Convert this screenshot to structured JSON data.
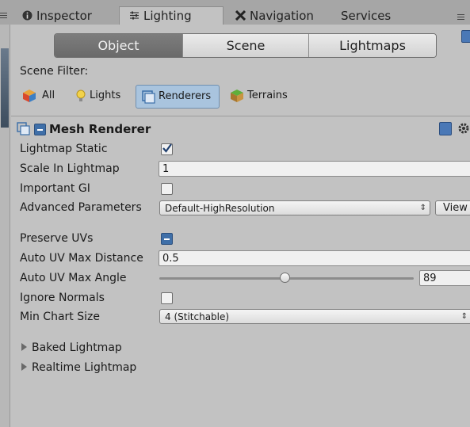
{
  "tabs": [
    {
      "label": "Inspector",
      "icon": "info-icon",
      "active": false
    },
    {
      "label": "Lighting",
      "icon": "lighting-icon",
      "active": true
    },
    {
      "label": "Navigation",
      "icon": "navigation-icon",
      "active": false
    },
    {
      "label": "Services",
      "icon": "",
      "active": false
    }
  ],
  "mode_tabs": [
    {
      "label": "Object",
      "active": true
    },
    {
      "label": "Scene",
      "active": false
    },
    {
      "label": "Lightmaps",
      "active": false
    }
  ],
  "scene_filter": {
    "label": "Scene Filter:",
    "buttons": [
      {
        "label": "All",
        "icon": "all-cube-icon",
        "active": false
      },
      {
        "label": "Lights",
        "icon": "light-bulb-icon",
        "active": false
      },
      {
        "label": "Renderers",
        "icon": "renderer-icon",
        "active": true
      },
      {
        "label": "Terrains",
        "icon": "terrain-icon",
        "active": false
      }
    ]
  },
  "component": {
    "title": "Mesh Renderer",
    "icon": "mesh-renderer-icon"
  },
  "properties": {
    "lightmap_static": {
      "label": "Lightmap Static",
      "checked": true
    },
    "scale_in_lightmap": {
      "label": "Scale In Lightmap",
      "value": "1"
    },
    "important_gi": {
      "label": "Important GI",
      "checked": false
    },
    "advanced_parameters": {
      "label": "Advanced Parameters",
      "value": "Default-HighResolution",
      "view_label": "View"
    },
    "preserve_uvs": {
      "label": "Preserve UVs",
      "state": "mixed"
    },
    "auto_uv_max_distance": {
      "label": "Auto UV Max Distance",
      "value": "0.5"
    },
    "auto_uv_max_angle": {
      "label": "Auto UV Max Angle",
      "value": "89",
      "max": 180
    },
    "ignore_normals": {
      "label": "Ignore Normals",
      "checked": false
    },
    "min_chart_size": {
      "label": "Min Chart Size",
      "value": "4 (Stitchable)"
    }
  },
  "foldouts": {
    "baked": "Baked Lightmap",
    "realtime": "Realtime Lightmap"
  },
  "colors": {
    "panel_bg": "#c2c2c2",
    "selected_tab": "#727272",
    "filter_selected": "#a9c4de",
    "help_icon": "#4a78b6"
  }
}
